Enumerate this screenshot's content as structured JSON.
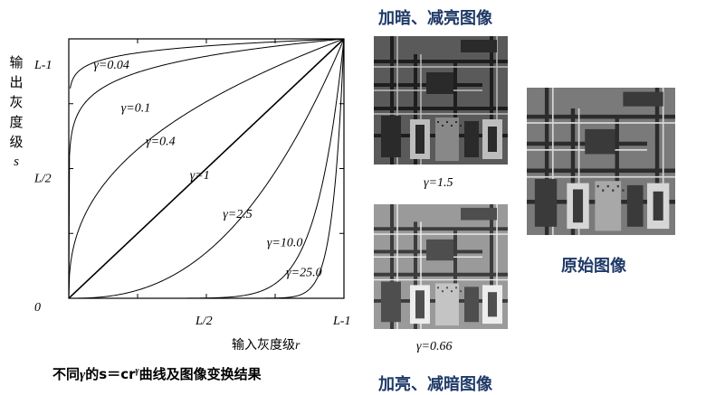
{
  "chart_data": {
    "type": "line",
    "title": "",
    "ylabel_chars": [
      "输",
      "出",
      "灰",
      "度",
      "级"
    ],
    "ylabel_symbol": "s",
    "xlabel": "输入灰度级",
    "xlabel_symbol": "r",
    "x_ticks": [
      {
        "value": 0,
        "label": "0"
      },
      {
        "value": 0.5,
        "label": "L/2"
      },
      {
        "value": 1,
        "label": "L-1"
      }
    ],
    "y_ticks": [
      {
        "value": 0.5,
        "label": "L/2"
      },
      {
        "value": 1,
        "label": "L-1"
      }
    ],
    "xlim": [
      0,
      1
    ],
    "ylim": [
      0,
      1
    ],
    "grid": false,
    "series": [
      {
        "name": "γ=0.04",
        "gamma": 0.04,
        "x_start": 0.005
      },
      {
        "name": "γ=0.1",
        "gamma": 0.1,
        "x_start": 0
      },
      {
        "name": "γ=0.4",
        "gamma": 0.4,
        "x_start": 0
      },
      {
        "name": "γ=1",
        "gamma": 1,
        "x_start": 0
      },
      {
        "name": "γ=2.5",
        "gamma": 2.5,
        "x_start": 0
      },
      {
        "name": "γ=10.0",
        "gamma": 10,
        "x_start": 0
      },
      {
        "name": "γ=25.0",
        "gamma": 25,
        "x_start": 0
      }
    ]
  },
  "caption": "不同γ的s=crγ曲线及图像变换结果",
  "caption_parts": {
    "before": "不同",
    "gamma": "γ",
    "middle": "的s＝cr",
    "sup": "γ",
    "after": "曲线及图像变换结果"
  },
  "images": {
    "top_heading": "加暗、减亮图像",
    "top_label": "γ=1.5",
    "bottom_label": "γ=0.66",
    "bottom_heading": "加亮、减暗图像",
    "original_label": "原始图像"
  },
  "colors": {
    "heading": "#1f3a68",
    "curve": "#000000"
  }
}
